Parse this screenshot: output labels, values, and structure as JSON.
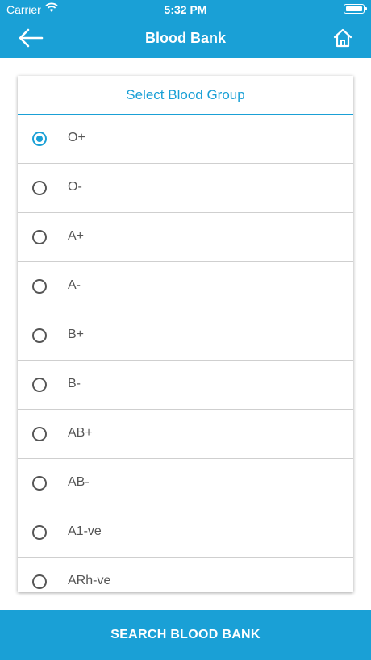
{
  "status_bar": {
    "carrier": "Carrier",
    "time": "5:32 PM"
  },
  "header": {
    "title": "Blood Bank",
    "back_icon": "arrow-left-icon",
    "home_icon": "home-icon"
  },
  "blood_group": {
    "heading": "Select Blood Group",
    "selected": "O+",
    "options": [
      "O+",
      "O-",
      "A+",
      "A-",
      "B+",
      "B-",
      "AB+",
      "AB-",
      "A1-ve",
      "ARh-ve"
    ]
  },
  "actions": {
    "search_label": "SEARCH BLOOD BANK"
  },
  "colors": {
    "accent": "#1aa0d6",
    "divider": "#cfcfcf",
    "text": "#555555"
  }
}
